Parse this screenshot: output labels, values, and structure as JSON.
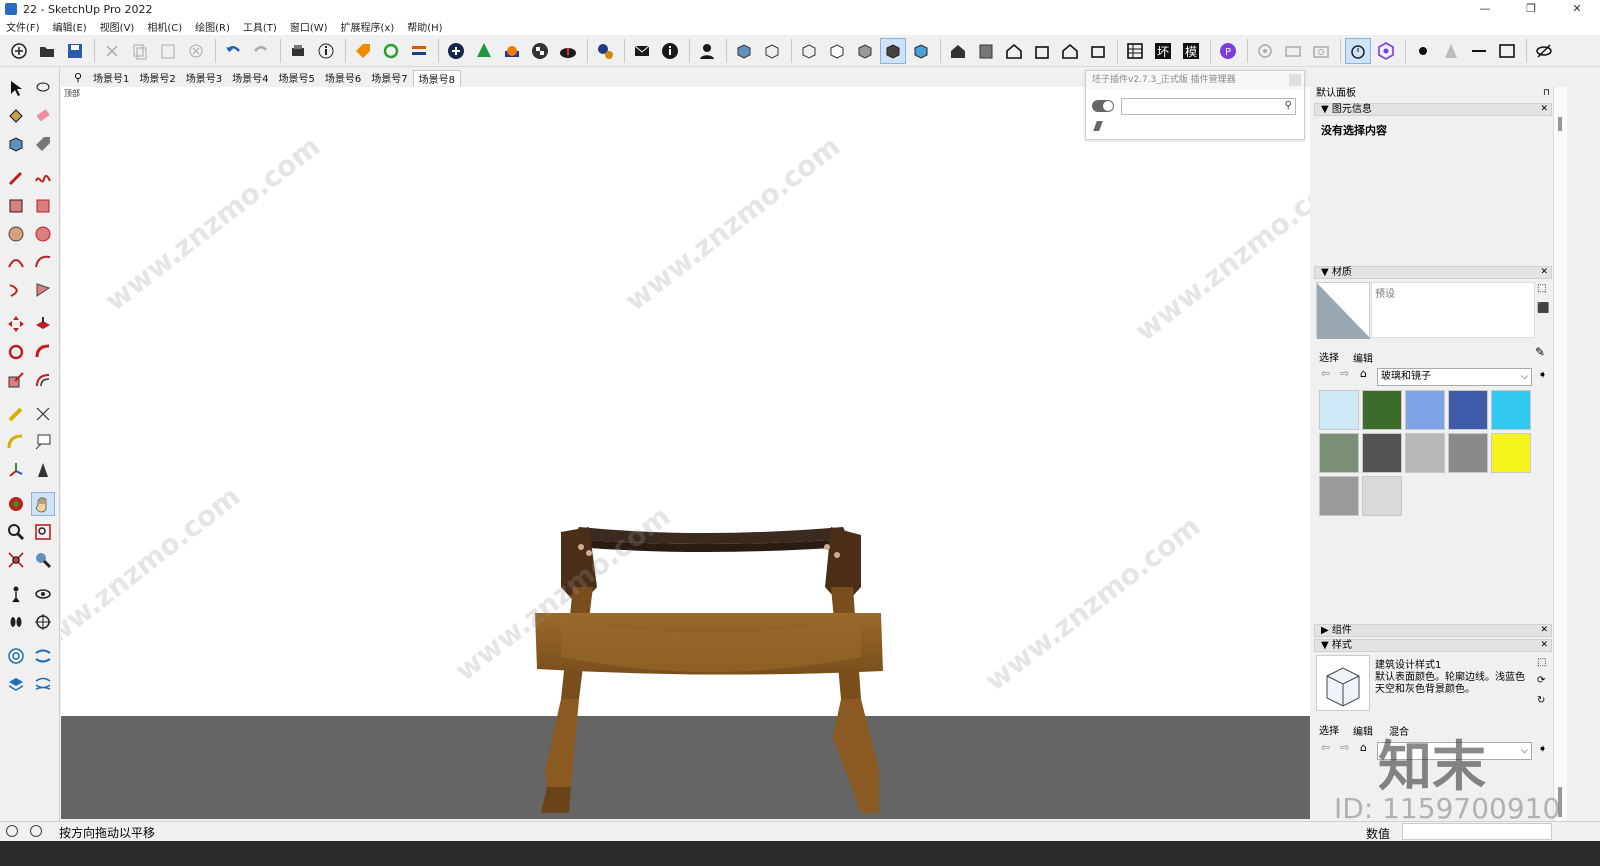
{
  "window": {
    "title": "22 - SketchUp Pro 2022",
    "controls": [
      "—",
      "❐",
      "✕"
    ]
  },
  "menu": [
    "文件(F)",
    "编辑(E)",
    "视图(V)",
    "相机(C)",
    "绘图(R)",
    "工具(T)",
    "窗口(W)",
    "扩展程序(x)",
    "帮助(H)"
  ],
  "scenes": {
    "search_icon": "⚲",
    "tabs": [
      "场景号1",
      "场景号2",
      "场景号3",
      "场景号4",
      "场景号5",
      "场景号6",
      "场景号7",
      "场景号8"
    ],
    "active": 7
  },
  "viewport": {
    "label": "顶部"
  },
  "plugin": {
    "title": "坯子插件v2.7.3_正式版 插件管理器",
    "search_placeholder": ""
  },
  "tray": {
    "title": "默认面板",
    "entity_info": {
      "header": "图元信息",
      "content": "没有选择内容"
    },
    "materials": {
      "header": "材质",
      "preview_label": "预设",
      "tab_select": "选择",
      "tab_edit": "编辑",
      "library": "玻璃和镜子",
      "swatches": [
        "#cde9f5",
        "#3d6b2a",
        "#7da2e6",
        "#3d5ba8",
        "#33c8ef",
        "#7b8f77",
        "#535353",
        "#b8b8b8",
        "#8a8a8a",
        "#f5f51e",
        "#9a9a9a",
        "#d9d9d9"
      ]
    },
    "components": {
      "header": "组件"
    },
    "styles": {
      "header": "样式",
      "style_name": "建筑设计样式1",
      "style_desc": "默认表面颜色。轮廓边线。浅蓝色天空和灰色背景颜色。",
      "tab_select": "选择",
      "tab_edit": "编辑",
      "tab_mix": "混合"
    }
  },
  "status": {
    "message": "按方向拖动以平移",
    "value_label": "数值"
  },
  "watermarks": {
    "site": "www.znzmo.com",
    "brand": "知末",
    "id": "ID: 1159700910"
  }
}
